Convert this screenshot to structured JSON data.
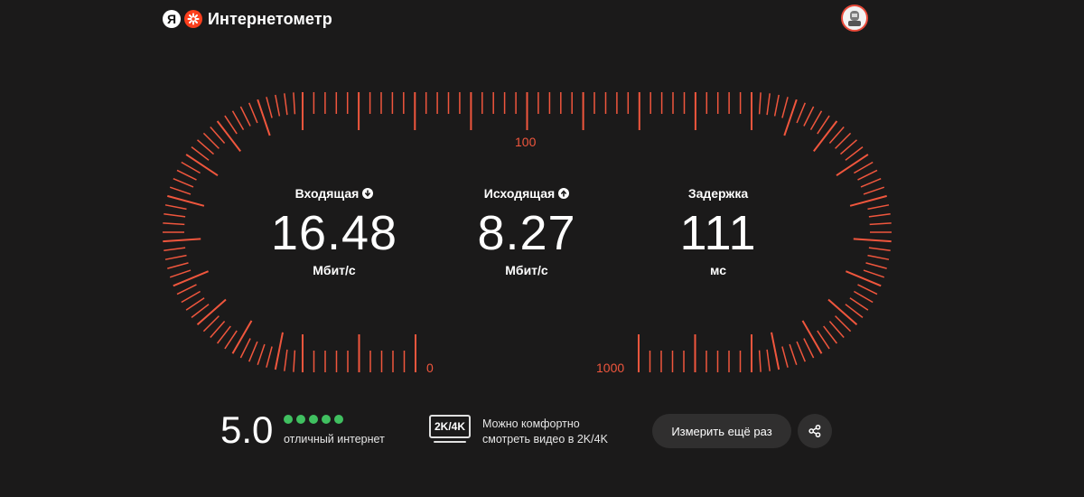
{
  "header": {
    "ya_letter": "Я",
    "title": "Интернетометр"
  },
  "gauge": {
    "color": "#f0563d",
    "scale_labels": {
      "top": "100",
      "bottom_left": "0",
      "bottom_right": "1000"
    }
  },
  "metrics": [
    {
      "title": "Входящая",
      "icon": "arrow-down-icon",
      "value": "16.48",
      "unit": "Мбит/с"
    },
    {
      "title": "Исходящая",
      "icon": "arrow-up-icon",
      "value": "8.27",
      "unit": "Мбит/с"
    },
    {
      "title": "Задержка",
      "value": "111",
      "unit": "мс"
    }
  ],
  "rating": {
    "value": "5.0",
    "stars_filled": 5,
    "stars_total": 5,
    "label": "отличный интернет",
    "star_color": "#40c060"
  },
  "video": {
    "badge": "2K/4K",
    "line1": "Можно комфортно",
    "line2": "смотреть видео в 2K/4K"
  },
  "actions": {
    "retry_label": "Измерить ещё раз",
    "share_icon": "share-icon"
  }
}
